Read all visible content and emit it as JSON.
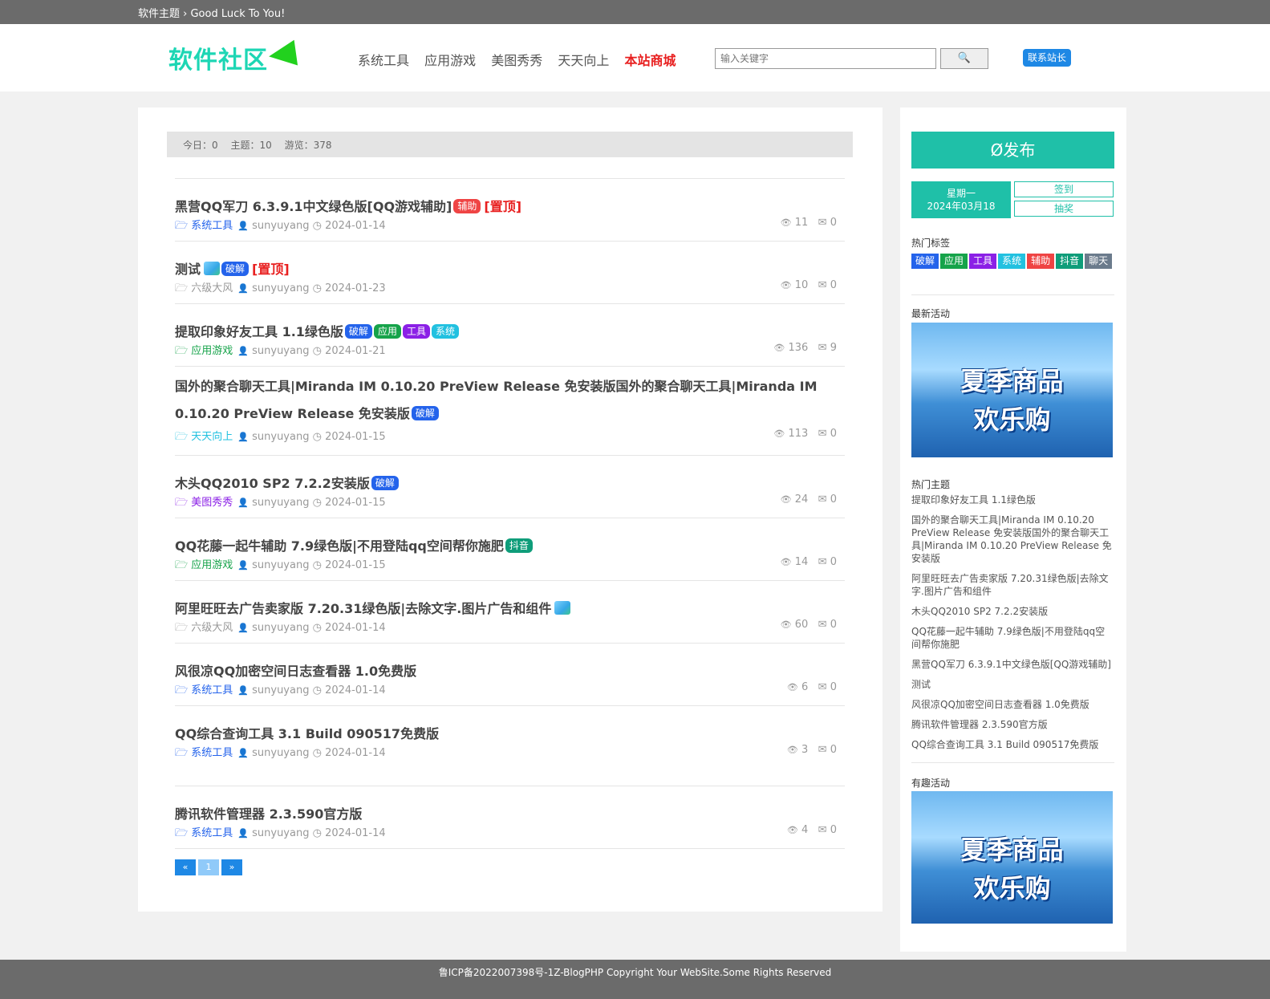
{
  "topbar": {
    "text": "软件主题 › Good Luck To You!"
  },
  "header": {
    "logo": "软件社区",
    "nav": [
      "系统工具",
      "应用游戏",
      "美图秀秀",
      "天天向上"
    ],
    "nav_highlight": "本站商城",
    "search_placeholder": "输入关键字",
    "search_icon": "🔍",
    "contact_label": "联系站长"
  },
  "stats": {
    "today": "今日：0",
    "topics": "主题：10",
    "views": "游览：378"
  },
  "icons": {
    "folder": "🗁",
    "user": "👤",
    "clock": "◷",
    "eye": "👁",
    "mail": "✉"
  },
  "posts": [
    {
      "title": "黑营QQ军刀 6.3.9.1中文绿色版[QQ游戏辅助]",
      "tags": [
        {
          "t": "辅助",
          "c": "t-red"
        }
      ],
      "pin": "[置顶]",
      "cat": "系统工具",
      "cat_color": "#2463eb",
      "user": "sunyuyang",
      "date": "2024-01-14",
      "views": "11",
      "replies": "0"
    },
    {
      "title": "测试",
      "img": true,
      "tags": [
        {
          "t": "破解",
          "c": "t-blue"
        }
      ],
      "pin": "[置顶]",
      "cat": "六级大风",
      "cat_color": "#999",
      "user": "sunyuyang",
      "date": "2024-01-23",
      "views": "10",
      "replies": "0"
    },
    {
      "title": "提取印象好友工具 1.1绿色版",
      "tags": [
        {
          "t": "破解",
          "c": "t-blue"
        },
        {
          "t": "应用",
          "c": "t-green"
        },
        {
          "t": "工具",
          "c": "t-purple"
        },
        {
          "t": "系统",
          "c": "t-cyan"
        }
      ],
      "cat": "应用游戏",
      "cat_color": "#16a34a",
      "user": "sunyuyang",
      "date": "2024-01-21",
      "views": "136",
      "replies": "9"
    },
    {
      "title": "国外的聚合聊天工具|Miranda IM 0.10.20 PreView Release 免安装版国外的聚合聊天工具|Miranda IM 0.10.20 PreView Release 免安装版",
      "two": true,
      "tags": [
        {
          "t": "破解",
          "c": "t-blue"
        }
      ],
      "cat": "天天向上",
      "cat_color": "#22c1e0",
      "user": "sunyuyang",
      "date": "2024-01-15",
      "views": "113",
      "replies": "0"
    },
    {
      "title": "木头QQ2010 SP2 7.2.2安装版",
      "tags": [
        {
          "t": "破解",
          "c": "t-blue"
        }
      ],
      "cat": "美图秀秀",
      "cat_color": "#8b20e6",
      "user": "sunyuyang",
      "date": "2024-01-15",
      "views": "24",
      "replies": "0"
    },
    {
      "title": "QQ花藤一起牛辅助 7.9绿色版|不用登陆qq空间帮你施肥",
      "tags": [
        {
          "t": "抖音",
          "c": "t-teal"
        }
      ],
      "cat": "应用游戏",
      "cat_color": "#16a34a",
      "user": "sunyuyang",
      "date": "2024-01-15",
      "views": "14",
      "replies": "0"
    },
    {
      "title": "阿里旺旺去广告卖家版 7.20.31绿色版|去除文字.图片广告和组件",
      "img": true,
      "tags": [],
      "cat": "六级大风",
      "cat_color": "#999",
      "user": "sunyuyang",
      "date": "2024-01-14",
      "views": "60",
      "replies": "0"
    },
    {
      "title": "风很凉QQ加密空间日志查看器 1.0免费版",
      "tags": [],
      "cat": "系统工具",
      "cat_color": "#2463eb",
      "user": "sunyuyang",
      "date": "2024-01-14",
      "views": "6",
      "replies": "0"
    },
    {
      "title": "QQ综合查询工具 3.1 Build 090517免费版",
      "tags": [],
      "cat": "系统工具",
      "cat_color": "#2463eb",
      "user": "sunyuyang",
      "date": "2024-01-14",
      "views": "3",
      "replies": "0"
    },
    {
      "title": "腾讯软件管理器 2.3.590官方版",
      "tags": [],
      "cat": "系统工具",
      "cat_color": "#2463eb",
      "user": "sunyuyang",
      "date": "2024-01-14",
      "views": "4",
      "replies": "0"
    }
  ],
  "pager": {
    "prev": "«",
    "current": "1",
    "next": "»"
  },
  "sidebar": {
    "post_button": "发布",
    "post_icon": "Ø",
    "weekday": "星期一",
    "date": "2024年03月18",
    "sign_in": "签到",
    "lottery": "抽奖",
    "hot_tags_title": "热门标签",
    "hot_tags": [
      {
        "t": "破解",
        "c": "t-blue"
      },
      {
        "t": "应用",
        "c": "t-green"
      },
      {
        "t": "工具",
        "c": "t-purple"
      },
      {
        "t": "系统",
        "c": "t-cyan"
      },
      {
        "t": "辅助",
        "c": "t-red"
      },
      {
        "t": "抖音",
        "c": "t-teal"
      },
      {
        "t": "聊天",
        "c": "t-gray"
      }
    ],
    "latest_title": "最新活动",
    "banner_line1": "夏季商品",
    "banner_line2": "欢乐购",
    "hot_topics_title": "热门主题",
    "hot_topics": [
      "提取印象好友工具 1.1绿色版",
      "国外的聚合聊天工具|Miranda IM 0.10.20 PreView Release 免安装版国外的聚合聊天工具|Miranda IM 0.10.20 PreView Release 免安装版",
      "阿里旺旺去广告卖家版 7.20.31绿色版|去除文字.图片广告和组件",
      "木头QQ2010 SP2 7.2.2安装版",
      "QQ花藤一起牛辅助 7.9绿色版|不用登陆qq空间帮你施肥",
      "黑营QQ军刀 6.3.9.1中文绿色版[QQ游戏辅助]",
      "测试",
      "风很凉QQ加密空间日志查看器 1.0免费版",
      "腾讯软件管理器 2.3.590官方版",
      "QQ综合查询工具 3.1 Build 090517免费版"
    ],
    "fun_title": "有趣活动"
  },
  "footer": {
    "text": "鲁ICP备2022007398号-1Z-BlogPHP Copyright Your WebSite.Some Rights Reserved"
  }
}
